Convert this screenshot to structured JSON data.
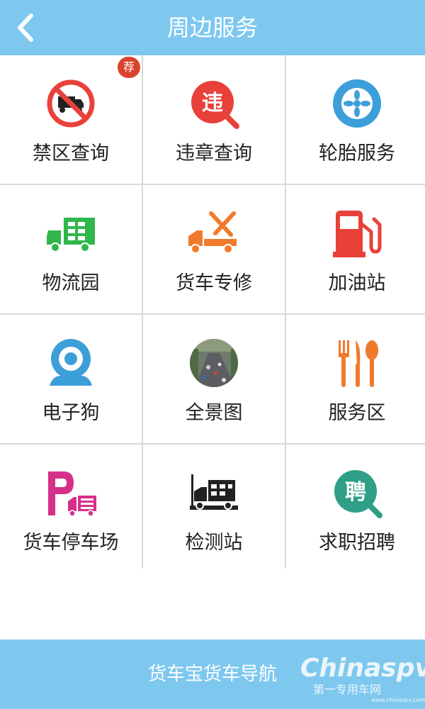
{
  "header": {
    "title": "周边服务",
    "back_icon": "back-arrow-icon"
  },
  "colors": {
    "header_bg": "#7ec8ef",
    "red": "#e8413a",
    "green": "#2fb74b",
    "orange": "#f07a2c",
    "blue": "#3d9fd9",
    "magenta": "#d6308b",
    "teal": "#2f9f87"
  },
  "services": [
    {
      "label": "禁区查询",
      "icon": "no-truck-icon",
      "badge": "荐"
    },
    {
      "label": "违章查询",
      "icon": "violation-search-icon"
    },
    {
      "label": "轮胎服务",
      "icon": "tire-icon"
    },
    {
      "label": "物流园",
      "icon": "logistics-truck-icon"
    },
    {
      "label": "货车专修",
      "icon": "truck-repair-icon"
    },
    {
      "label": "加油站",
      "icon": "fuel-pump-icon"
    },
    {
      "label": "电子狗",
      "icon": "speed-camera-icon"
    },
    {
      "label": "全景图",
      "icon": "panorama-photo-icon"
    },
    {
      "label": "服务区",
      "icon": "fork-knife-spoon-icon"
    },
    {
      "label": "货车停车场",
      "icon": "truck-parking-icon"
    },
    {
      "label": "检测站",
      "icon": "inspection-station-icon"
    },
    {
      "label": "求职招聘",
      "icon": "job-recruit-icon"
    }
  ],
  "footer": {
    "text": "货车宝货车导航"
  },
  "watermark": {
    "brand": "Chinaspv",
    "sub": "第一专用车网",
    "url": "www.chinaspv.com"
  }
}
